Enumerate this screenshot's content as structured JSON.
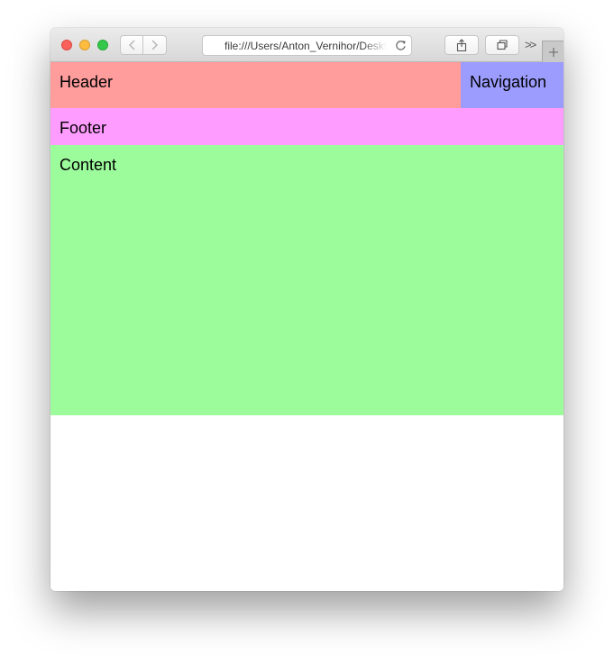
{
  "browser": {
    "url": "file:///Users/Anton_Vernihor/Desktop/index.html",
    "toolbar": {
      "back_icon": "chevron-left-icon",
      "forward_icon": "chevron-right-icon",
      "reload_icon": "reload-icon",
      "share_icon": "share-icon",
      "tabs_icon": "tabs-overview-icon",
      "overflow_label": ">>",
      "newtab_icon": "plus-icon"
    }
  },
  "page": {
    "header": {
      "label": "Header",
      "color": "#ff9c9c"
    },
    "navigation": {
      "label": "Navigation",
      "color": "#9c9cff"
    },
    "footer": {
      "label": "Footer",
      "color": "#ff9cff"
    },
    "content": {
      "label": "Content",
      "color": "#9cfc9c"
    }
  }
}
